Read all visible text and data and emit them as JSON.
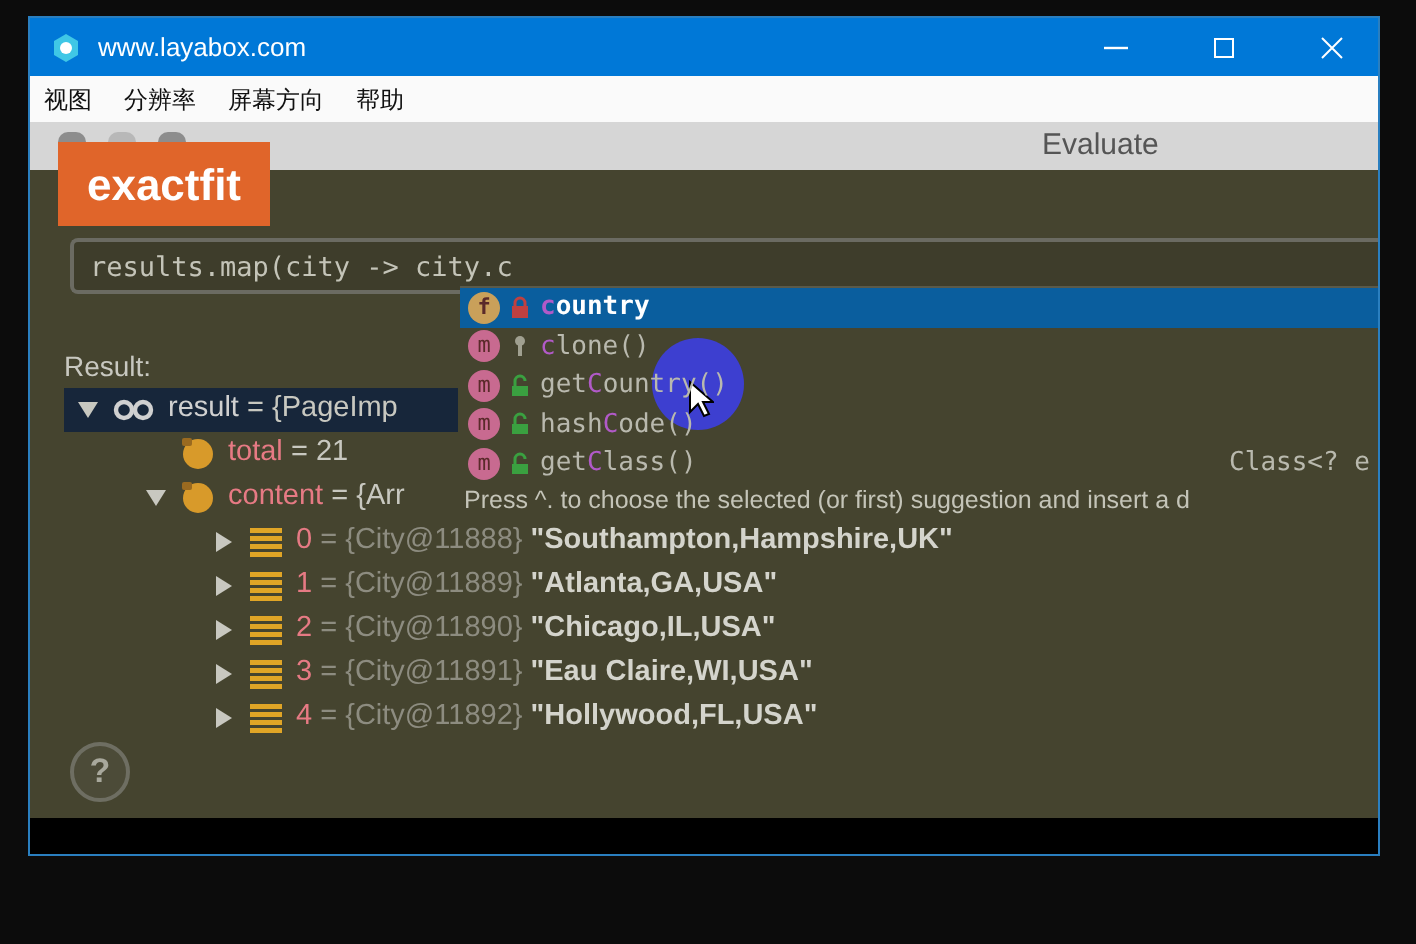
{
  "window": {
    "title": "www.layabox.com"
  },
  "menu": [
    "视图",
    "分辨率",
    "屏幕方向",
    "帮助"
  ],
  "dialog": {
    "title": "Evaluate",
    "overlay_label": "exactfit",
    "expression": "results.map(city -> city.c",
    "suggestions": [
      {
        "badge": "f",
        "kind": "field",
        "private": true,
        "protected": false,
        "match": "c",
        "after": "ountry",
        "selected": true
      },
      {
        "badge": "m",
        "kind": "method",
        "private": false,
        "protected": true,
        "match": "c",
        "after": "lone()",
        "selected": false
      },
      {
        "badge": "m",
        "kind": "method",
        "private": false,
        "protected": false,
        "before": "get",
        "match": "C",
        "after": "ountry()",
        "selected": false
      },
      {
        "badge": "m",
        "kind": "method",
        "private": false,
        "protected": false,
        "before": "hash",
        "match": "C",
        "after": "ode()",
        "selected": false
      },
      {
        "badge": "m",
        "kind": "method",
        "private": false,
        "protected": false,
        "before": "get",
        "match": "C",
        "after": "lass()",
        "type_hint": "Class<? e",
        "selected": false
      }
    ],
    "hint": "Press ^. to choose the selected (or first) suggestion and insert a d",
    "result_label": "Result:",
    "tree": [
      {
        "kind": "result",
        "name": "result",
        "rest": "= {PageImp",
        "expanded": true,
        "selected": true,
        "children": [
          {
            "kind": "field",
            "name": "total",
            "rest": "= 21"
          },
          {
            "kind": "field",
            "name": "content",
            "rest": "= {Arr",
            "expanded": true,
            "children": [
              {
                "kind": "item",
                "name": "0",
                "rest": "= {City@11888}",
                "value": "\"Southampton,Hampshire,UK\"",
                "expanded": false
              },
              {
                "kind": "item",
                "name": "1",
                "rest": "= {City@11889}",
                "value": "\"Atlanta,GA,USA\"",
                "expanded": false
              },
              {
                "kind": "item",
                "name": "2",
                "rest": "= {City@11890}",
                "value": "\"Chicago,IL,USA\"",
                "expanded": false
              },
              {
                "kind": "item",
                "name": "3",
                "rest": "= {City@11891}",
                "value": "\"Eau Claire,WI,USA\"",
                "expanded": false
              },
              {
                "kind": "item",
                "name": "4",
                "rest": "= {City@11892}",
                "value": "\"Hollywood,FL,USA\"",
                "expanded": false
              }
            ]
          }
        ]
      }
    ],
    "help_label": "?"
  }
}
